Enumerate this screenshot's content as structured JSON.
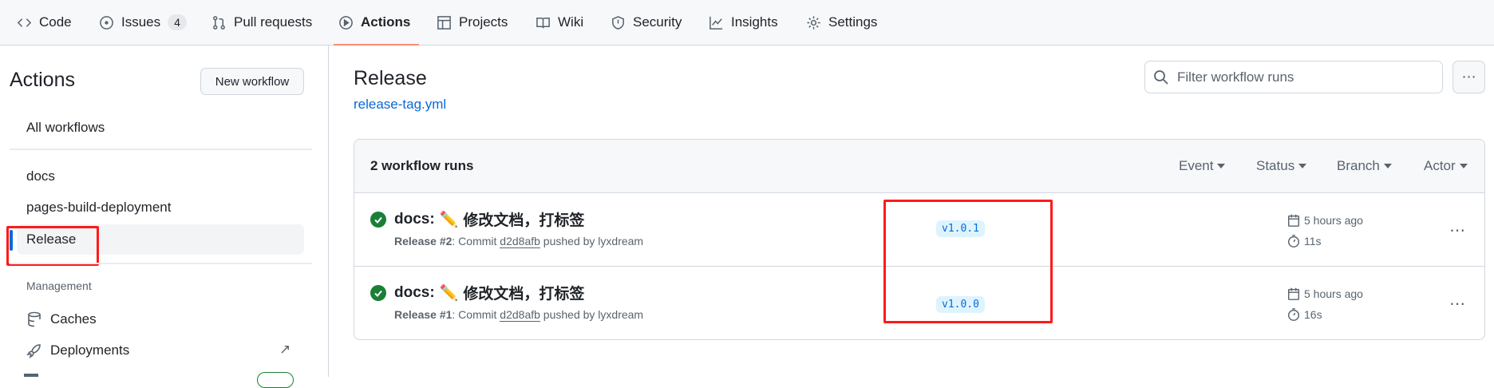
{
  "tabs": [
    {
      "label": "Code",
      "icon": "code-icon"
    },
    {
      "label": "Issues",
      "icon": "issue-icon",
      "count": "4"
    },
    {
      "label": "Pull requests",
      "icon": "pull-request-icon"
    },
    {
      "label": "Actions",
      "icon": "play-icon",
      "active": true
    },
    {
      "label": "Projects",
      "icon": "table-icon"
    },
    {
      "label": "Wiki",
      "icon": "book-icon"
    },
    {
      "label": "Security",
      "icon": "shield-icon"
    },
    {
      "label": "Insights",
      "icon": "graph-icon"
    },
    {
      "label": "Settings",
      "icon": "gear-icon"
    }
  ],
  "sidebar": {
    "title": "Actions",
    "new_workflow": "New workflow",
    "all_workflows": "All workflows",
    "workflows": [
      "docs",
      "pages-build-deployment",
      "Release"
    ],
    "selected": "Release",
    "management_heading": "Management",
    "management": [
      {
        "label": "Caches",
        "icon": "database-icon"
      },
      {
        "label": "Deployments",
        "icon": "rocket-icon"
      }
    ]
  },
  "main": {
    "title": "Release",
    "file_link": "release-tag.yml",
    "filter_placeholder": "Filter workflow runs",
    "run_count": "2 workflow runs",
    "filters": [
      "Event",
      "Status",
      "Branch",
      "Actor"
    ],
    "runs": [
      {
        "prefix": "docs:",
        "emoji": "✏️",
        "title": "修改文档，打标签",
        "workflow": "Release #2",
        "commit_text": ": Commit",
        "commit": "d2d8afb",
        "pushed_by": "pushed by lyxdream",
        "tag": "v1.0.1",
        "time": "5 hours ago",
        "duration": "11s",
        "status": "success"
      },
      {
        "prefix": "docs:",
        "emoji": "✏️",
        "title": "修改文档，打标签",
        "workflow": "Release #1",
        "commit_text": ": Commit",
        "commit": "d2d8afb",
        "pushed_by": "pushed by lyxdream",
        "tag": "v1.0.0",
        "time": "5 hours ago",
        "duration": "16s",
        "status": "success"
      }
    ]
  },
  "colors": {
    "accent": "#0969da",
    "success": "#1a7f37",
    "active_tab_underline": "#fd8c73",
    "annotation": "#ff1a1a"
  }
}
